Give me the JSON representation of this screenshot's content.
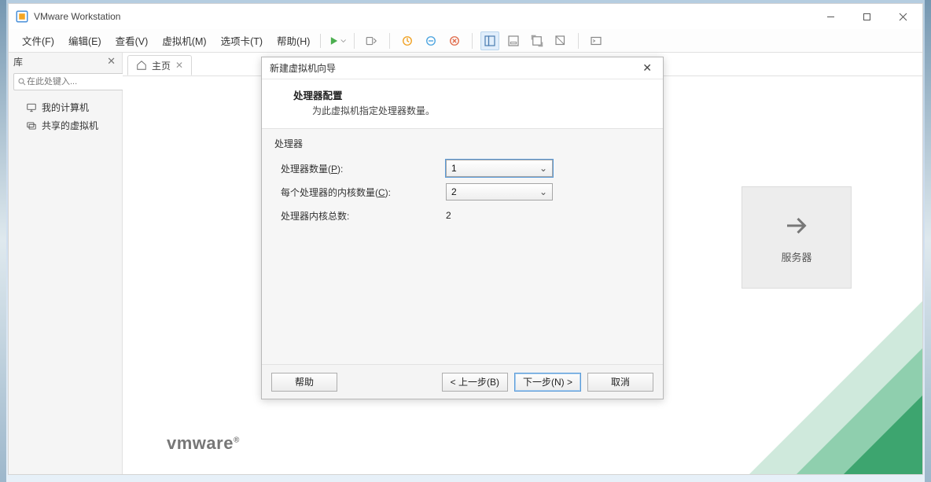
{
  "window": {
    "title": "VMware Workstation"
  },
  "menu": {
    "file": "文件(F)",
    "edit": "编辑(E)",
    "view": "查看(V)",
    "vm": "虚拟机(M)",
    "tabs": "选项卡(T)",
    "help": "帮助(H)"
  },
  "sidebar": {
    "title": "库",
    "search_placeholder": "在此处键入...",
    "items": [
      {
        "label": "我的计算机"
      },
      {
        "label": "共享的虚拟机"
      }
    ]
  },
  "tab": {
    "home": "主页"
  },
  "home": {
    "remote_label": "服务器",
    "brand": "vmware"
  },
  "dialog": {
    "title": "新建虚拟机向导",
    "heading": "处理器配置",
    "subheading": "为此虚拟机指定处理器数量。",
    "group_label": "处理器",
    "proc_count_label_pre": "处理器数量(",
    "proc_count_key": "P",
    "label_suf": "):",
    "proc_count_value": "1",
    "cores_label_pre": "每个处理器的内核数量(",
    "cores_key": "C",
    "cores_value": "2",
    "total_label": "处理器内核总数:",
    "total_value": "2",
    "btn_help": "帮助",
    "btn_back": "< 上一步(B)",
    "btn_next": "下一步(N) >",
    "btn_cancel": "取消"
  }
}
